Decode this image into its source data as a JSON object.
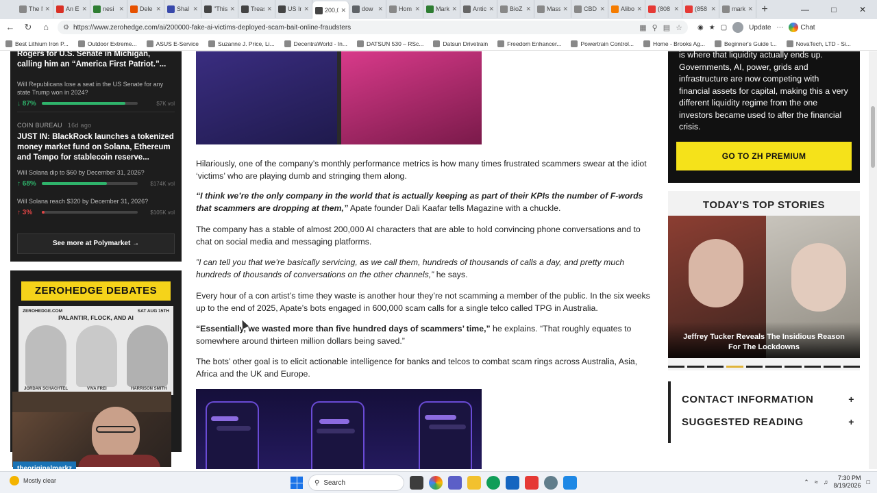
{
  "browser": {
    "tabs": [
      {
        "label": "The N",
        "color": "#888888"
      },
      {
        "label": "An E",
        "color": "#d93025"
      },
      {
        "label": "nesi",
        "color": "#2e7d32"
      },
      {
        "label": "Dele",
        "color": "#e65100"
      },
      {
        "label": "Shal",
        "color": "#3949ab"
      },
      {
        "label": "\"This",
        "color": "#444444"
      },
      {
        "label": "Treas",
        "color": "#444444"
      },
      {
        "label": "US In",
        "color": "#444444"
      },
      {
        "label": "200,0",
        "color": "#444444",
        "active": true
      },
      {
        "label": "dow",
        "color": "#5f6368"
      },
      {
        "label": "Hom",
        "color": "#888888"
      },
      {
        "label": "Mark",
        "color": "#2e7d32"
      },
      {
        "label": "Antic",
        "color": "#666666"
      },
      {
        "label": "BioZ",
        "color": "#888888"
      },
      {
        "label": "Mass",
        "color": "#888888"
      },
      {
        "label": "CBD",
        "color": "#888888"
      },
      {
        "label": "Alibo",
        "color": "#f57c00"
      },
      {
        "label": "(808",
        "color": "#e53935"
      },
      {
        "label": "(858",
        "color": "#e53935"
      },
      {
        "label": "mark",
        "color": "#888888"
      }
    ],
    "new_tab": "+",
    "url": "https://www.zerohedge.com/ai/200000-fake-ai-victims-deployed-scam-bait-online-fraudsters",
    "update_label": "Update",
    "chat_label": "Chat",
    "bookmarks": [
      "Best Lithium Iron P...",
      "Outdoor Extreme...",
      "ASUS E-Service",
      "Suzanne J. Price, Li...",
      "DecentraWorld - In...",
      "DATSUN 530 – RSc...",
      "Datsun Drivetrain",
      "Freedom Enhancer...",
      "Powertrain Control...",
      "Home - Brooks Ag...",
      "Beginner's Guide t...",
      "NovaTech, LTD - Si..."
    ]
  },
  "polymarket": {
    "headline1": "Rogers for U.S. Senate in Michigan, calling him an “America First Patriot.”...",
    "q1": "Will Republicans lose a seat in the US Senate for any state Trump won in 2024?",
    "q1_pct": "↓ 87%",
    "q1_frac": 0.87,
    "q1_vol": "$7K vol",
    "source2": "COIN BUREAU",
    "source2_ago": "16d ago",
    "headline2": "JUST IN: BlackRock launches a tokenized money market fund on Solana, Ethereum and Tempo for stablecoin reserve...",
    "q2": "Will Solana dip to $60 by December 31, 2026?",
    "q2_pct": "↑ 68%",
    "q2_frac": 0.68,
    "q2_vol": "$174K vol",
    "q3": "Will Solana reach $320 by December 31, 2026?",
    "q3_pct": "↑ 3%",
    "q3_frac": 0.03,
    "q3_vol": "$105K vol",
    "more_label": "See more at Polymarket →",
    "green": "#2fb36b",
    "red": "#e04545"
  },
  "debates": {
    "banner": "ZEROHEDGE DEBATES",
    "site": "ZEROHEDGE.COM",
    "date": "SAT AUG 15TH",
    "title": "PALANTIR, FLOCK, AND AI",
    "names": [
      "JORDAN SCHACHTEL",
      "VIVA FREI",
      "HARRISON SMITH"
    ]
  },
  "webcam": {
    "name": "theoriginalmarkz"
  },
  "article": {
    "p1": "Hilariously, one of the company’s monthly performance metrics is how many times frustrated scammers swear at the idiot ‘victims’ who are playing dumb and stringing them along.",
    "p2_quote": "“I think we’re the only company in the world that is actually keeping as part of their KPIs the number of F-words that scammers are dropping at them,”",
    "p2_rest": " Apate founder Dali Kaafar tells Magazine with a chuckle.",
    "p3": "The company has a stable of almost 200,000 AI characters that are able to hold convincing phone conversations and to chat on social media and messaging platforms.",
    "p4_quote": "”I can tell you that we’re basically servicing, as we call them, hundreds of thousands of calls a day, and pretty much hundreds of thousands of conversations on the other channels,”",
    "p4_rest": " he says.",
    "p5": "Every hour of a con artist’s time they waste is another hour they’re not scamming a member of the public. In the six weeks up to the end of 2025, Apate’s bots engaged in 600,000 scam calls for a single telco called TPG in Australia.",
    "p6_quote": "“Essentially, we wasted more than five hundred days of scammers’ time,”",
    "p6_rest": " he explains. “That roughly equates to somewhere around thirteen million dollars being saved.”",
    "p7": "The bots’ other goal is to elicit actionable intelligence for banks and telcos to combat scam rings across Australia, Asia, Africa and the UK and Europe."
  },
  "premium": {
    "text": "is where that liquidity actually ends up. Governments, AI, power, grids and infrastructure are now competing with financial assets for capital, making this a very different liquidity regime from the one investors became used to after the financial crisis.",
    "button": "GO TO ZH PREMIUM"
  },
  "top_stories": {
    "title": "TODAY'S TOP STORIES",
    "caption": "Jeffrey Tucker Reveals The Insidious Reason For The Lockdowns",
    "dots": 10,
    "active_dot": 3
  },
  "accordion": {
    "contact": "CONTACT INFORMATION",
    "reading": "SUGGESTED READING",
    "plus": "+"
  },
  "taskbar": {
    "weather": "Mostly clear",
    "search": "Search",
    "time": "7:30 PM",
    "date": "8/19/2026"
  }
}
